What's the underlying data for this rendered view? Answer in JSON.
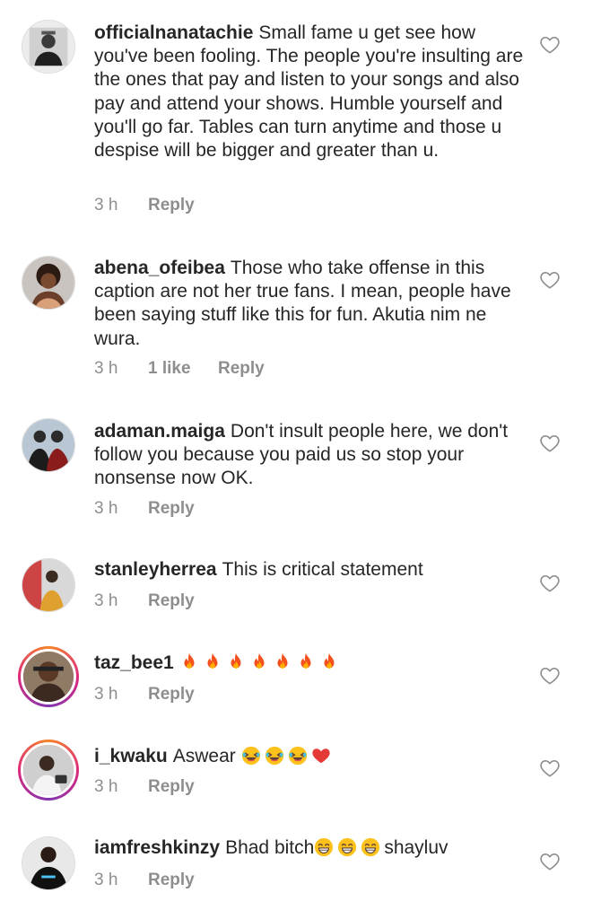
{
  "comments": [
    {
      "username": "officialnanatachie",
      "text": "Small fame u get see how you've been fooling. The people you're insulting are the ones that pay and listen to your songs and also pay and attend your shows. Humble yourself and you'll go far. Tables can turn anytime and those u despise will be bigger and greater than u.",
      "time": "3 h",
      "likes": "",
      "reply": "Reply"
    },
    {
      "username": "abena_ofeibea",
      "text": "Those who take offense in this caption are not her true fans. I mean, people have been saying stuff like this for fun. Akutia nim ne wura.",
      "time": "3 h",
      "likes": "1 like",
      "reply": "Reply"
    },
    {
      "username": "adaman.maiga",
      "text": "Don't insult people here, we don't follow you because you paid us so stop your nonsense now OK.",
      "time": "3 h",
      "likes": "",
      "reply": "Reply"
    },
    {
      "username": "stanleyherrea",
      "text": "This is critical statement",
      "time": "3 h",
      "likes": "",
      "reply": "Reply"
    },
    {
      "username": "taz_bee1",
      "text": "",
      "emojis": [
        "fire-emoji",
        "fire-emoji",
        "fire-emoji",
        "fire-emoji",
        "fire-emoji",
        "fire-emoji",
        "fire-emoji"
      ],
      "time": "3 h",
      "likes": "",
      "reply": "Reply"
    },
    {
      "username": "i_kwaku",
      "text": "Aswear",
      "emojis": [
        "rofl-emoji",
        "rofl-emoji",
        "rofl-emoji",
        "red-heart-emoji"
      ],
      "time": "3 h",
      "likes": "",
      "reply": "Reply"
    },
    {
      "username": "iamfreshkinzy",
      "text": "Bhad bitch",
      "emojis": [
        "grin-emoji",
        "grin-emoji",
        "grin-emoji"
      ],
      "text_after": "shayluv",
      "time": "3 h",
      "likes": "",
      "reply": "Reply"
    }
  ],
  "colors": {
    "text": "#262626",
    "meta": "#8e8e8e",
    "story_ring_start": "#f58529",
    "story_ring_end": "#dd2a7b"
  }
}
